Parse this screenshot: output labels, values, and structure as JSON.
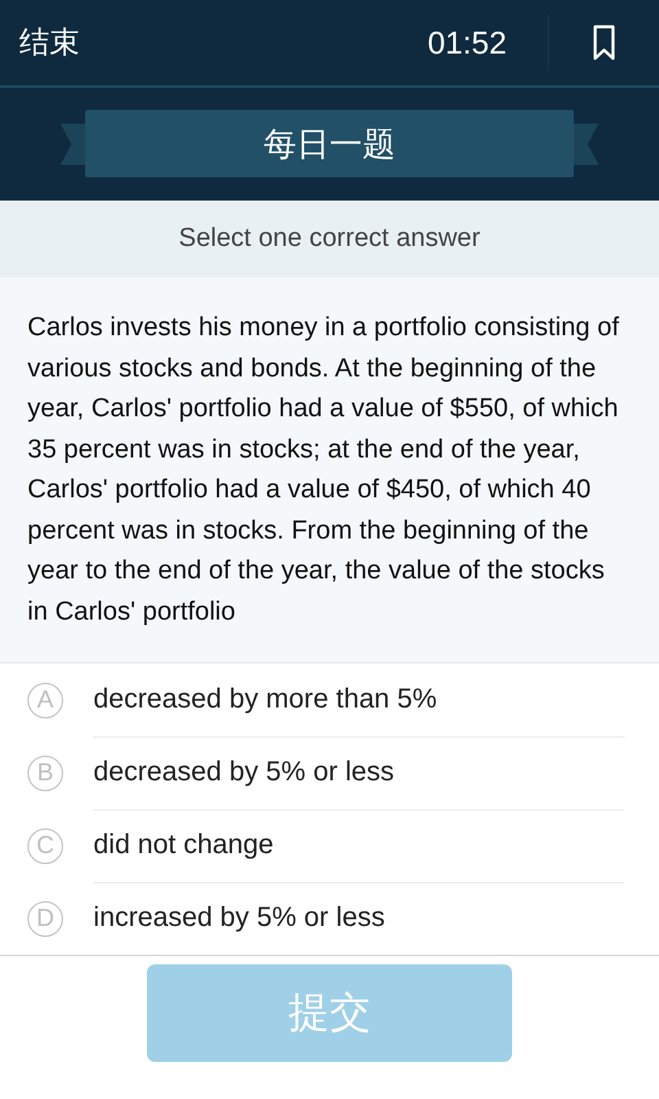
{
  "header": {
    "end_label": "结束",
    "timer": "01:52"
  },
  "banner": {
    "title": "每日一题"
  },
  "instruction": "Select one correct answer",
  "question": "Carlos invests his money in a portfolio consisting of various stocks and bonds. At the beginning of the year, Carlos' portfolio had a value of $550, of which 35 percent was in stocks; at the end of the year, Carlos' portfolio had a value of $450, of which 40 percent was in stocks. From the beginning of the year to the end of the year, the value of the stocks in Carlos' portfolio",
  "options": [
    {
      "letter": "A",
      "text": "decreased by more than 5%",
      "selected": false
    },
    {
      "letter": "B",
      "text": "decreased by 5% or less",
      "selected": false
    },
    {
      "letter": "C",
      "text": "did not change",
      "selected": false
    },
    {
      "letter": "D",
      "text": "increased by 5% or less",
      "selected": false
    }
  ],
  "submit": {
    "label": "提交",
    "disabled": true
  }
}
